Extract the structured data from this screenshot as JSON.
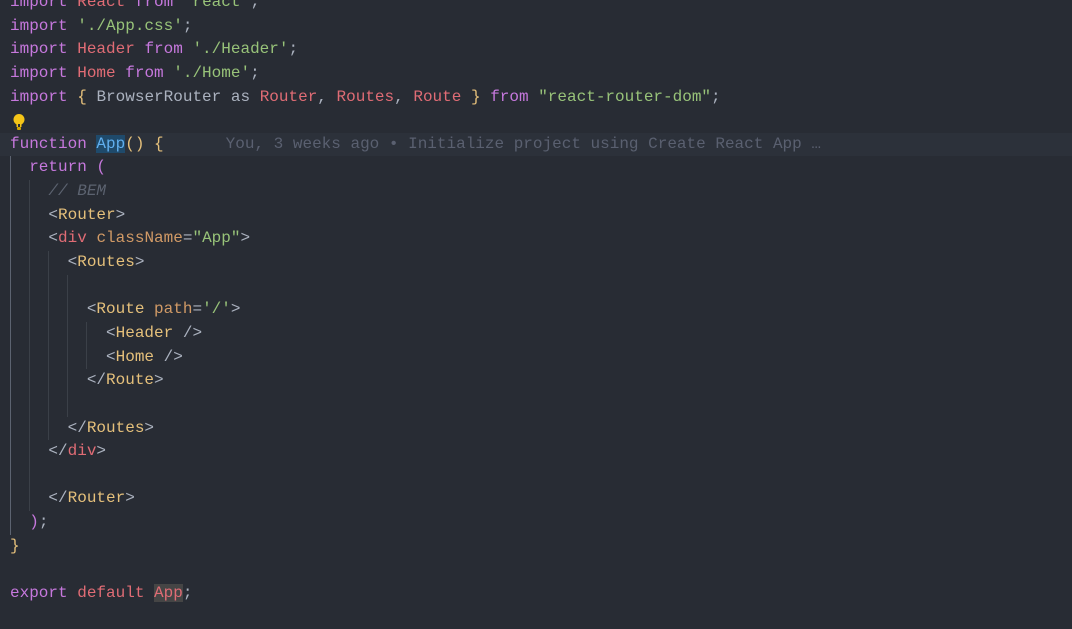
{
  "editor": {
    "theme_colors": {
      "background": "#282c34",
      "keyword": "#c678dd",
      "variable": "#e06c75",
      "string": "#98c379",
      "function": "#61afef",
      "brace": "#e5c07b",
      "comment": "#5c6370",
      "attribute": "#d19a66"
    },
    "lines": {
      "l0": "import React from 'react'; // cut off",
      "l1": {
        "kw": "import",
        "str": "'./App.css'",
        "end": ";"
      },
      "l2": {
        "kw": "import",
        "name": "Header",
        "from": "from",
        "str": "'./Header'",
        "end": ";"
      },
      "l3": {
        "kw": "import",
        "name": "Home",
        "from": "from",
        "str": "'./Home'",
        "end": ";"
      },
      "l4": {
        "kw": "import",
        "open": "{",
        "browser_router": "BrowserRouter",
        "as": "as",
        "router": "Router",
        "c1": ",",
        "routes": "Routes",
        "c2": ",",
        "route": "Route",
        "close": "}",
        "from": "from",
        "str": "\"react-router-dom\"",
        "end": ";"
      },
      "l6": {
        "kw": "function",
        "name": "App",
        "parens": "()",
        "brace": "{"
      },
      "l7": {
        "kw": "return",
        "paren": "("
      },
      "l8": {
        "comment": "// BEM"
      },
      "l9": {
        "lt": "<",
        "tag": "Router",
        "gt": ">"
      },
      "l10": {
        "lt": "<",
        "tag": "div",
        "attr": "className",
        "eq": "=",
        "str": "\"App\"",
        "gt": ">"
      },
      "l11": {
        "lt": "<",
        "tag": "Routes",
        "gt": ">"
      },
      "l13": {
        "lt": "<",
        "tag": "Route",
        "attr": "path",
        "eq": "=",
        "str": "'/'",
        "gt": ">"
      },
      "l14": {
        "lt": "<",
        "tag": "Header",
        "end": " />"
      },
      "l15": {
        "lt": "<",
        "tag": "Home",
        "end": " />"
      },
      "l16": {
        "lt": "</",
        "tag": "Route",
        "gt": ">"
      },
      "l18": {
        "lt": "</",
        "tag": "Routes",
        "gt": ">"
      },
      "l19": {
        "lt": "</",
        "tag": "div",
        "gt": ">"
      },
      "l21": {
        "lt": "</",
        "tag": "Router",
        "gt": ">"
      },
      "l22": {
        "paren": ")",
        "end": ";"
      },
      "l23": {
        "brace": "}"
      },
      "l25": {
        "kw": "export",
        "default": "default",
        "name": "App",
        "end": ";"
      }
    },
    "blame": "You, 3 weeks ago • Initialize project using Create React App …",
    "lightbulb_icon": "lightbulb-icon"
  }
}
